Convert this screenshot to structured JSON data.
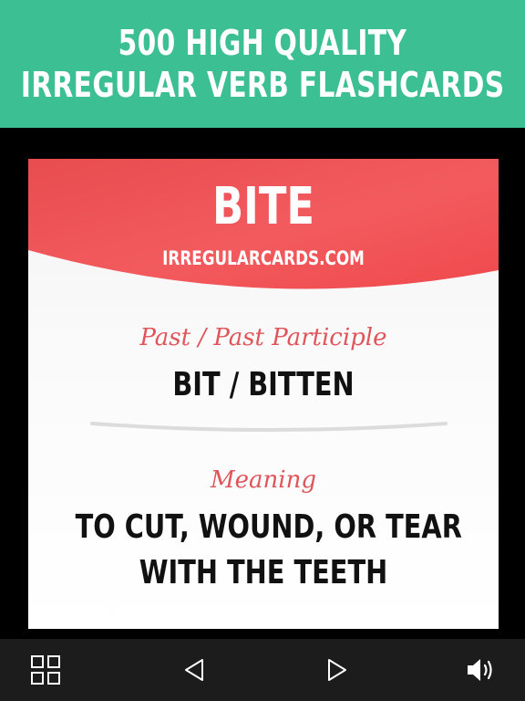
{
  "banner": {
    "line1": "500 HIGH QUALITY",
    "line2": "IRREGULAR VERB FLASHCARDS"
  },
  "card": {
    "verb": "BITE",
    "site": "IRREGULARCARDS.COM",
    "past_label": "Past / Past Participle",
    "past_forms": "BIT / BITTEN",
    "meaning_label": "Meaning",
    "meaning_line1": "TO CUT, WOUND, OR TEAR",
    "meaning_line2": "WITH THE TEETH"
  },
  "controls": {
    "grid": "grid-icon",
    "prev": "previous-arrow-icon",
    "next": "next-arrow-icon",
    "sound": "speaker-icon"
  },
  "colors": {
    "banner": "#3cbf92",
    "card_header": "#ef4f52",
    "script_label": "#e0555a",
    "bottom_bar": "#1c1c1c"
  }
}
